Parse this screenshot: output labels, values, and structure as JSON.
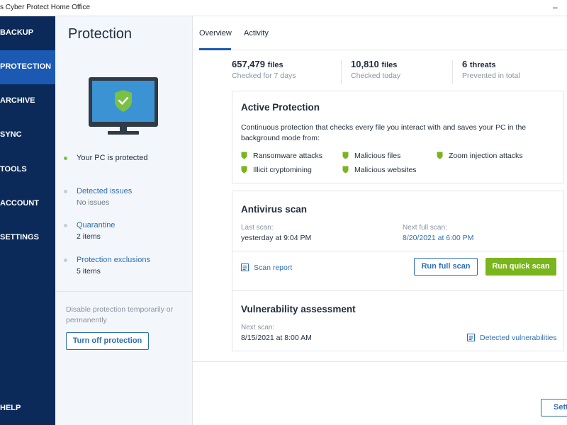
{
  "window": {
    "title": "s Cyber Protect Home Office",
    "minimize_glyph": "–"
  },
  "nav": {
    "items": [
      {
        "label": "BACKUP",
        "active": false
      },
      {
        "label": "PROTECTION",
        "active": true
      },
      {
        "label": "ARCHIVE",
        "active": false
      },
      {
        "label": "SYNC",
        "active": false
      },
      {
        "label": "TOOLS",
        "active": false
      },
      {
        "label": "ACCOUNT",
        "active": false
      },
      {
        "label": "SETTINGS",
        "active": false
      }
    ],
    "help_label": "HELP"
  },
  "side": {
    "title": "Protection",
    "pc_status": "Your PC is protected",
    "items": [
      {
        "label": "Detected issues",
        "value": "No issues"
      },
      {
        "label": "Quarantine",
        "value": "2 items"
      },
      {
        "label": "Protection exclusions",
        "value": "5 items"
      }
    ],
    "disable_note": "Disable protection temporarily or permanently",
    "turn_off_button": "Turn off protection"
  },
  "tabs": [
    {
      "label": "Overview",
      "active": true
    },
    {
      "label": "Activity",
      "active": false
    }
  ],
  "stats": [
    {
      "value": "657,479",
      "unit": "files",
      "label": "Checked for 7 days"
    },
    {
      "value": "10,810",
      "unit": "files",
      "label": "Checked today"
    },
    {
      "value": "6",
      "unit": "threats",
      "label": "Prevented in total"
    }
  ],
  "active_protection": {
    "title": "Active Protection",
    "description": "Continuous protection that checks every file you interact with and saves your PC in the background mode from:",
    "features": [
      "Ransomware attacks",
      "Malicious files",
      "Zoom injection attacks",
      "Illicit cryptomining",
      "Malicious websites"
    ]
  },
  "antivirus": {
    "title": "Antivirus scan",
    "last_scan_label": "Last scan:",
    "last_scan_value": "yesterday at 9:04 PM",
    "next_scan_label": "Next full scan:",
    "next_scan_value": "8/20/2021 at 6:00 PM",
    "report_link": "Scan report",
    "full_scan_button": "Run full scan",
    "quick_scan_button": "Run quick scan"
  },
  "vulnerability": {
    "title": "Vulnerability assessment",
    "next_scan_label": "Next scan:",
    "next_scan_value": "8/15/2021 at 8:00 AM",
    "detected_link": "Detected vulnerabilities"
  },
  "settings_button": "Settings",
  "colors": {
    "nav_bg": "#0b2a5a",
    "nav_active": "#1b59b3",
    "accent": "#2f6fb4",
    "success": "#7ab51d"
  }
}
